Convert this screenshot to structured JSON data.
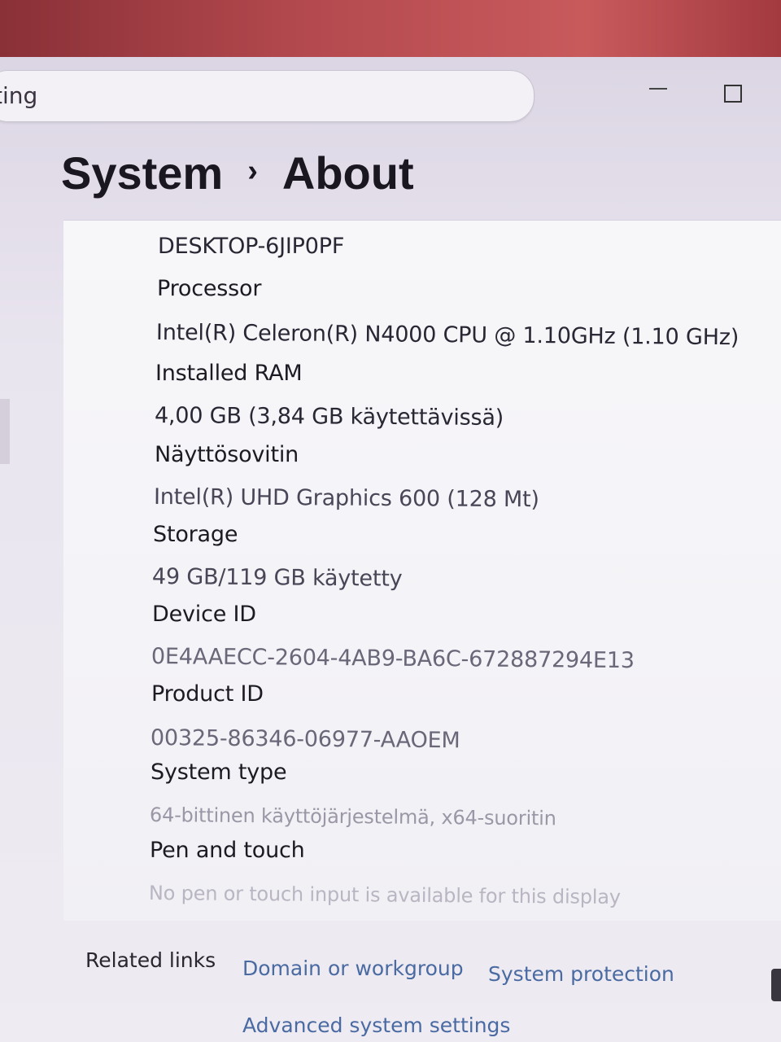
{
  "search": {
    "text": "tting"
  },
  "breadcrumb": {
    "parent": "System",
    "separator": "›",
    "current": "About"
  },
  "device_name": "DESKTOP-6JIP0PF",
  "specs": {
    "processor_label": "Processor",
    "processor_value": "Intel(R) Celeron(R) N4000 CPU @ 1.10GHz (1.10 GHz)",
    "ram_label": "Installed RAM",
    "ram_value": "4,00 GB (3,84 GB käytettävissä)",
    "gpu_label": "Näyttösovitin",
    "gpu_value": "Intel(R) UHD Graphics 600 (128 Mt)",
    "storage_label": "Storage",
    "storage_value": "49 GB/119 GB käytetty",
    "device_id_label": "Device ID",
    "device_id_value": "0E4AAECC-2604-4AB9-BA6C-672887294E13",
    "product_id_label": "Product ID",
    "product_id_value": "00325-86346-06977-AAOEM",
    "system_type_label": "System type",
    "system_type_value": "64-bittinen käyttöjärjestelmä, x64-suoritin",
    "pen_touch_label": "Pen and touch",
    "pen_touch_value": "No pen or touch input is available for this display"
  },
  "related": {
    "label": "Related links",
    "domain": "Domain or workgroup",
    "protection": "System protection",
    "advanced": "Advanced system settings"
  }
}
